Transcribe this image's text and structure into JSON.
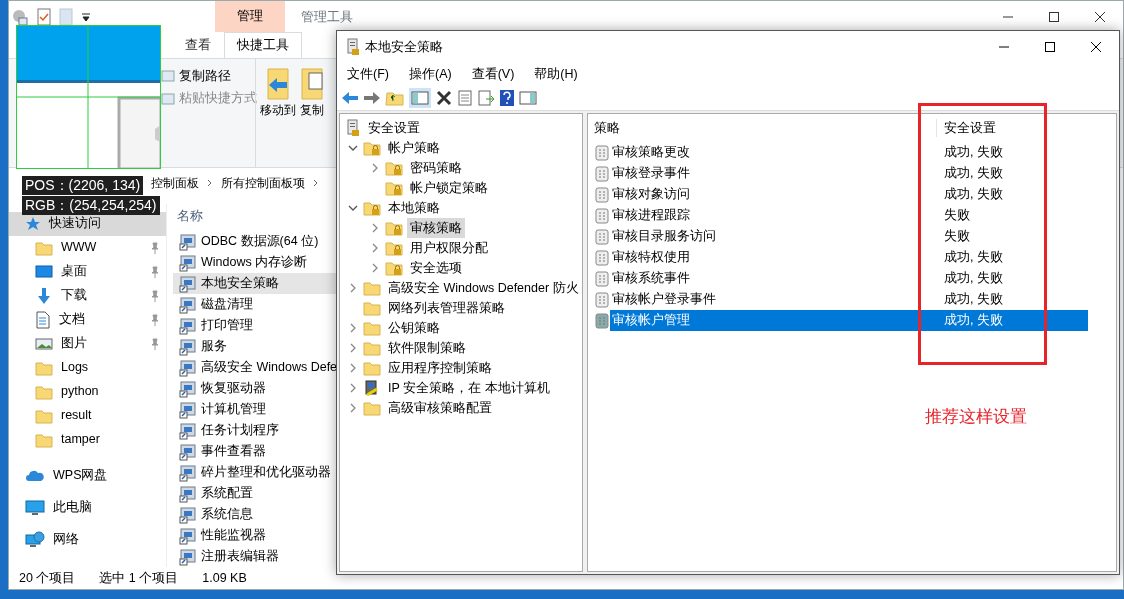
{
  "explorer": {
    "title": "管理工具",
    "context_tab": "管理",
    "tabs": [
      {
        "label": "查看",
        "selected": false
      },
      {
        "label": "快捷工具",
        "selected": true
      }
    ],
    "ribbon": {
      "small_buttons": [
        "复制路径",
        "粘贴快捷方式"
      ],
      "large_buttons": [
        "移动到",
        "复制"
      ]
    },
    "breadcrumb": [
      "控制面板",
      "所有控制面板项"
    ],
    "nav": [
      {
        "label": "快速访问",
        "kind": "star",
        "pinned": false,
        "selected": true
      },
      {
        "label": "WWW",
        "kind": "folder",
        "pinned": true,
        "selected": false
      },
      {
        "label": "桌面",
        "kind": "desktop",
        "pinned": true,
        "selected": false
      },
      {
        "label": "下载",
        "kind": "download",
        "pinned": true,
        "selected": false
      },
      {
        "label": "文档",
        "kind": "document",
        "pinned": true,
        "selected": false
      },
      {
        "label": "图片",
        "kind": "pictures",
        "pinned": true,
        "selected": false
      },
      {
        "label": "Logs",
        "kind": "folder",
        "pinned": false,
        "selected": false
      },
      {
        "label": "python",
        "kind": "folder",
        "pinned": false,
        "selected": false
      },
      {
        "label": "result",
        "kind": "folder",
        "pinned": false,
        "selected": false
      },
      {
        "label": "tamper",
        "kind": "folder",
        "pinned": false,
        "selected": false
      },
      {
        "label": "WPS网盘",
        "kind": "cloud",
        "pinned": false,
        "selected": false
      },
      {
        "label": "此电脑",
        "kind": "computer",
        "pinned": false,
        "selected": false
      },
      {
        "label": "网络",
        "kind": "network",
        "pinned": false,
        "selected": false
      }
    ],
    "column_header": "名称",
    "files": [
      {
        "name": "ODBC 数据源(64 位)",
        "selected": false
      },
      {
        "name": "Windows 内存诊断",
        "selected": false
      },
      {
        "name": "本地安全策略",
        "selected": true
      },
      {
        "name": "磁盘清理",
        "selected": false
      },
      {
        "name": "打印管理",
        "selected": false
      },
      {
        "name": "服务",
        "selected": false
      },
      {
        "name": "高级安全 Windows Defe",
        "selected": false
      },
      {
        "name": "恢复驱动器",
        "selected": false
      },
      {
        "name": "计算机管理",
        "selected": false
      },
      {
        "name": "任务计划程序",
        "selected": false
      },
      {
        "name": "事件查看器",
        "selected": false
      },
      {
        "name": "碎片整理和优化驱动器",
        "selected": false
      },
      {
        "name": "系统配置",
        "selected": false
      },
      {
        "name": "系统信息",
        "selected": false
      },
      {
        "name": "性能监视器",
        "selected": false
      },
      {
        "name": "注册表编辑器",
        "selected": false
      }
    ],
    "status": [
      "20 个项目",
      "选中 1 个项目",
      "1.09 KB"
    ]
  },
  "picker": {
    "pos": "POS：(2206, 134)",
    "rgb": "RGB：(254,254,254)"
  },
  "mmc": {
    "title": "本地安全策略",
    "menu": [
      "文件(F)",
      "操作(A)",
      "查看(V)",
      "帮助(H)"
    ],
    "tree": [
      {
        "label": "安全设置",
        "kind": "policy",
        "expandable": false,
        "selected": false,
        "children": [
          {
            "label": "帐户策略",
            "kind": "locked-folder",
            "expandable": true,
            "expanded": true,
            "selected": false,
            "children": [
              {
                "label": "密码策略",
                "kind": "locked-folder",
                "expandable": true,
                "expanded": false,
                "selected": false
              },
              {
                "label": "帐户锁定策略",
                "kind": "locked-folder",
                "expandable": false,
                "selected": false
              }
            ]
          },
          {
            "label": "本地策略",
            "kind": "locked-folder",
            "expandable": true,
            "expanded": true,
            "selected": false,
            "children": [
              {
                "label": "审核策略",
                "kind": "locked-folder",
                "expandable": true,
                "expanded": false,
                "selected": true
              },
              {
                "label": "用户权限分配",
                "kind": "locked-folder",
                "expandable": true,
                "expanded": false,
                "selected": false
              },
              {
                "label": "安全选项",
                "kind": "locked-folder",
                "expandable": true,
                "expanded": false,
                "selected": false
              }
            ]
          },
          {
            "label": "高级安全 Windows Defender 防火",
            "kind": "folder",
            "expandable": true,
            "expanded": false,
            "selected": false
          },
          {
            "label": "网络列表管理器策略",
            "kind": "folder",
            "expandable": false,
            "selected": false
          },
          {
            "label": "公钥策略",
            "kind": "folder",
            "expandable": true,
            "expanded": false,
            "selected": false
          },
          {
            "label": "软件限制策略",
            "kind": "folder",
            "expandable": true,
            "expanded": false,
            "selected": false
          },
          {
            "label": "应用程序控制策略",
            "kind": "folder",
            "expandable": true,
            "expanded": false,
            "selected": false
          },
          {
            "label": "IP 安全策略，在 本地计算机",
            "kind": "ip",
            "expandable": true,
            "expanded": false,
            "selected": false
          },
          {
            "label": "高级审核策略配置",
            "kind": "folder",
            "expandable": true,
            "expanded": false,
            "selected": false
          }
        ]
      }
    ],
    "columns": [
      "策略",
      "安全设置"
    ],
    "rows": [
      {
        "policy": "审核策略更改",
        "setting": "成功, 失败",
        "selected": false
      },
      {
        "policy": "审核登录事件",
        "setting": "成功, 失败",
        "selected": false
      },
      {
        "policy": "审核对象访问",
        "setting": "成功, 失败",
        "selected": false
      },
      {
        "policy": "审核进程跟踪",
        "setting": "失败",
        "selected": false
      },
      {
        "policy": "审核目录服务访问",
        "setting": "失败",
        "selected": false
      },
      {
        "policy": "审核特权使用",
        "setting": "成功, 失败",
        "selected": false
      },
      {
        "policy": "审核系统事件",
        "setting": "成功, 失败",
        "selected": false
      },
      {
        "policy": "审核帐户登录事件",
        "setting": "成功, 失败",
        "selected": false
      },
      {
        "policy": "审核帐户管理",
        "setting": "成功, 失败",
        "selected": true
      }
    ]
  },
  "annotation": {
    "text": "推荐这样设置"
  }
}
